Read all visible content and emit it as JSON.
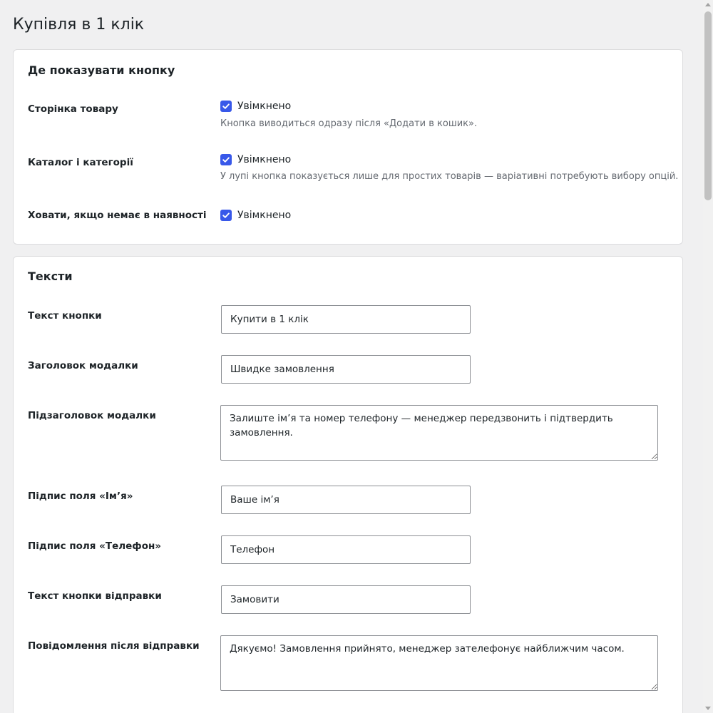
{
  "page": {
    "title": "Купівля в 1 клік"
  },
  "placement": {
    "title": "Де показувати кнопку",
    "rows": [
      {
        "label": "Сторінка товару",
        "checked": true,
        "checkbox_label": "Увімкнено",
        "description": "Кнопка виводиться одразу після «Додати в кошик»."
      },
      {
        "label": "Каталог і категорії",
        "checked": true,
        "checkbox_label": "Увімкнено",
        "description": "У лупі кнопка показується лише для простих товарів — варіативні потребують вибору опцій."
      },
      {
        "label": "Ховати, якщо немає в наявності",
        "checked": true,
        "checkbox_label": "Увімкнено",
        "description": ""
      }
    ]
  },
  "texts": {
    "title": "Тексти",
    "button_text": {
      "label": "Текст кнопки",
      "value": "Купити в 1 клік"
    },
    "modal_title": {
      "label": "Заголовок модалки",
      "value": "Швидке замовлення"
    },
    "modal_subtitle": {
      "label": "Підзаголовок модалки",
      "value": "Залиште ім’я та номер телефону — менеджер передзвонить і підтвердить замовлення."
    },
    "name_label": {
      "label": "Підпис поля «Ім’я»",
      "value": "Ваше ім’я"
    },
    "phone_label": {
      "label": "Підпис поля «Телефон»",
      "value": "Телефон"
    },
    "submit_text": {
      "label": "Текст кнопки відправки",
      "value": "Замовити"
    },
    "success_message": {
      "label": "Повідомлення після відправки",
      "value": "Дякуємо! Замовлення прийнято, менеджер зателефонує найближчим часом."
    }
  },
  "colors": {
    "accent": "#3858e9",
    "page_bg": "#f0f0f1",
    "card_border": "#dcdcde",
    "description": "#646970"
  }
}
